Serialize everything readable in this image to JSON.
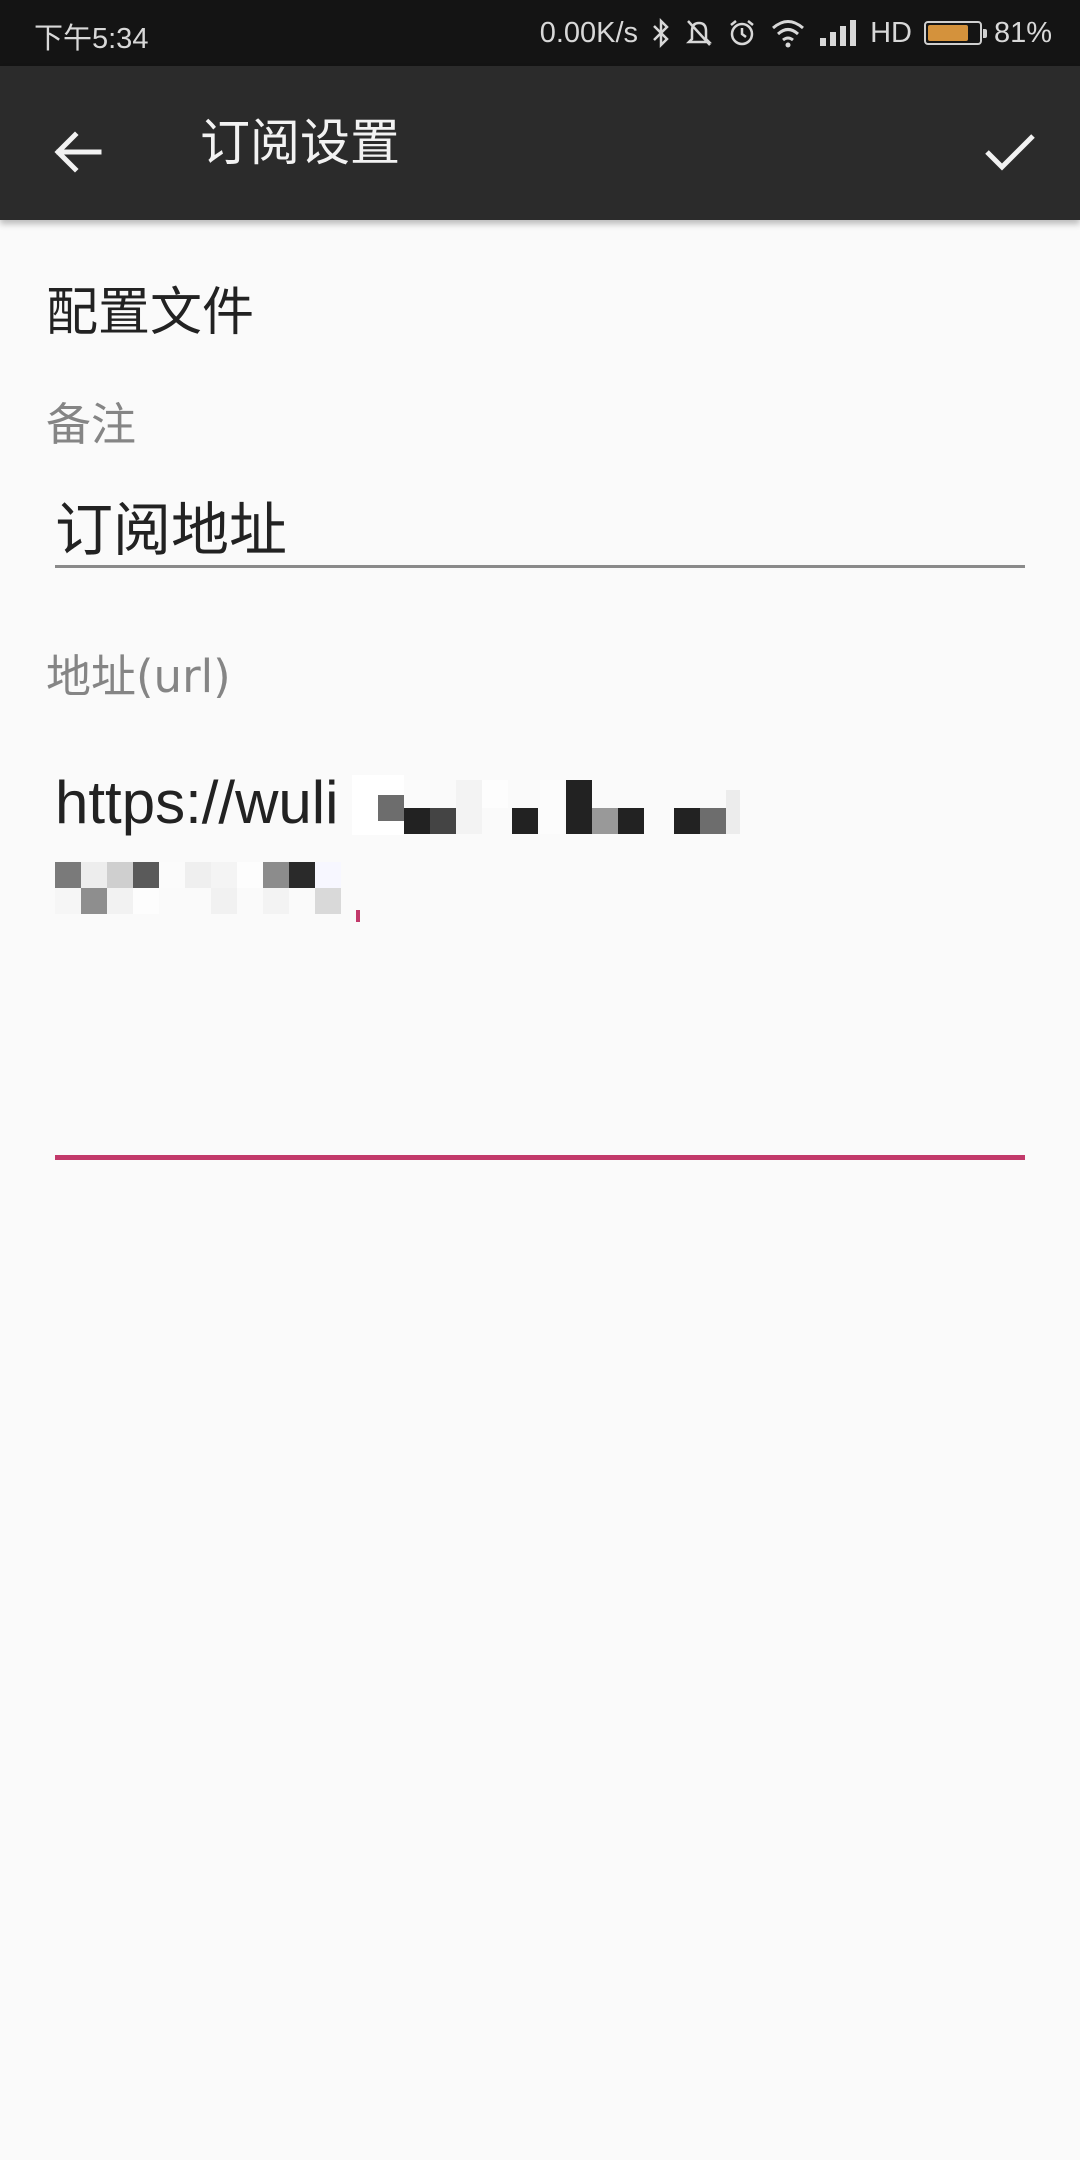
{
  "status_bar": {
    "time": "下午5:34",
    "net_speed": "0.00K/s",
    "network_type": "HD",
    "battery_percent": "81%",
    "battery_level": 0.81,
    "icons": [
      "bluetooth-icon",
      "mute-bell-icon",
      "alarm-icon",
      "wifi-icon",
      "signal-icon",
      "battery-icon"
    ]
  },
  "app_bar": {
    "title": "订阅设置",
    "back_icon": "arrow-back-icon",
    "confirm_icon": "check-icon"
  },
  "form": {
    "section_title": "配置文件",
    "remark": {
      "label": "备注",
      "value": "订阅地址"
    },
    "url": {
      "label": "地址(url)",
      "value_visible": "https://wuli"
    }
  },
  "colors": {
    "app_bar": "#2b2b2b",
    "status_bar": "#141414",
    "accent": "#c2396a",
    "background": "#fafafa",
    "battery": "#d4923c"
  }
}
